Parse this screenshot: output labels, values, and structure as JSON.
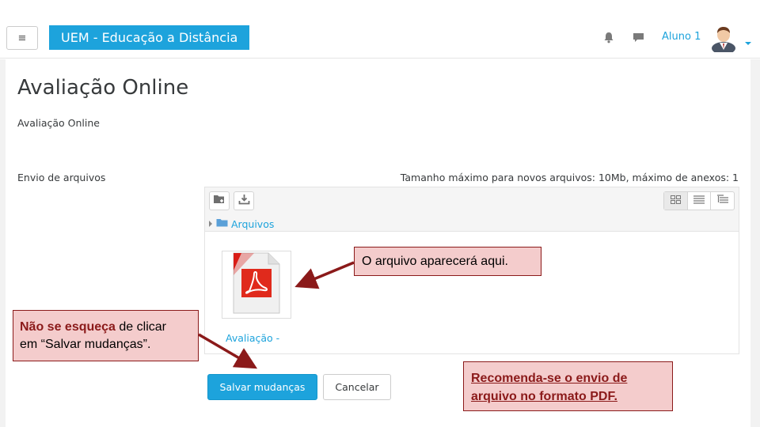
{
  "navbar": {
    "menu_glyph": "≡",
    "brand": "UEM - Educação a Distância",
    "user_name": "Aluno 1",
    "icons": [
      "hamburger-menu-icon",
      "bell-icon",
      "chat-icon",
      "avatar",
      "chevron-down-icon"
    ]
  },
  "page": {
    "title": "Avaliação Online",
    "subtitle": "Avaliação Online"
  },
  "upload": {
    "label": "Envio de arquivos",
    "max_info": "Tamanho máximo para novos arquivos: 10Mb, máximo de anexos: 1",
    "toolbar_icons": [
      "add-folder-icon",
      "download-icon"
    ],
    "view_icons": [
      "grid-view-icon",
      "list-view-icon",
      "tree-view-icon"
    ],
    "path_label": "Arquivos",
    "file": {
      "name": "Avaliação - ",
      "icon": "pdf-file-icon"
    }
  },
  "buttons": {
    "save": "Salvar mudanças",
    "cancel": "Cancelar"
  },
  "callouts": {
    "file_here": "O arquivo aparecerá aqui.",
    "save_bold": "Não se esqueça",
    "save_rest1": " de clicar",
    "save_rest2": "em “Salvar mudanças”.",
    "pdf_line1": "Recomenda-se o envio de",
    "pdf_line2": "arquivo no formato PDF."
  },
  "colors": {
    "brand": "#1da3dc",
    "callout_bg": "#f4cccc",
    "callout_accent": "#8b1a1a"
  }
}
